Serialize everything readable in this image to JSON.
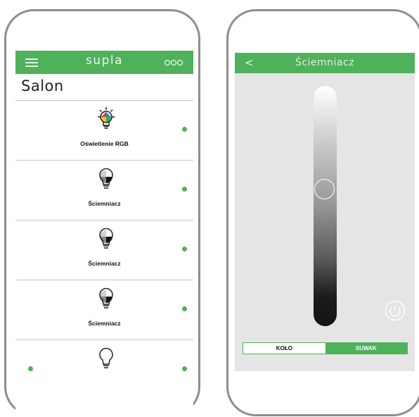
{
  "left_screen": {
    "topbar": {
      "brand": "supla",
      "menu_icon": "hamburger-icon",
      "more_icon": "three-circles-icon"
    },
    "location_title": "Salon",
    "channels": [
      {
        "caption": "Oświetlenie RGB",
        "icon": "rgb-bulb-icon",
        "online": true
      },
      {
        "caption": "Ściemniacz",
        "icon": "dimmer-bulb-icon",
        "online": true
      },
      {
        "caption": "Ściemniacz",
        "icon": "dimmer-bulb-icon",
        "online": true
      },
      {
        "caption": "Ściemniacz",
        "icon": "dimmer-bulb-icon",
        "online": true
      },
      {
        "caption": "",
        "icon": "bulb-outline-icon",
        "online": true
      }
    ]
  },
  "right_screen": {
    "title": "Ściemniacz",
    "back_label": "<",
    "slider_level": 0.58,
    "tabs": [
      {
        "label": "KOŁO",
        "selected": false
      },
      {
        "label": "SUWAK",
        "selected": true
      }
    ],
    "power_icon": "power-icon"
  },
  "colors": {
    "accent": "#4fb15a",
    "frame": "#8e8e8e",
    "panel_bg": "#e5e5e5"
  }
}
